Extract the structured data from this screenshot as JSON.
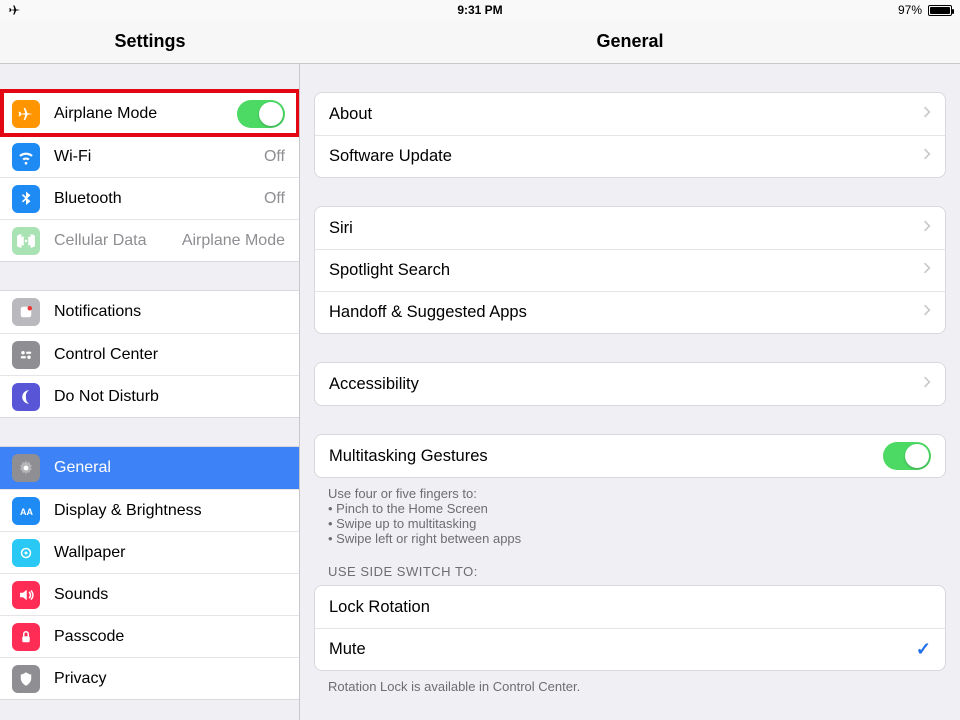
{
  "status": {
    "time": "9:31 PM",
    "battery_pct": "97%"
  },
  "header": {
    "left_title": "Settings",
    "right_title": "General"
  },
  "sidebar": {
    "group1": {
      "airplane": {
        "label": "Airplane Mode",
        "on": true
      },
      "wifi": {
        "label": "Wi-Fi",
        "value": "Off"
      },
      "bluetooth": {
        "label": "Bluetooth",
        "value": "Off"
      },
      "cellular": {
        "label": "Cellular Data",
        "value": "Airplane Mode"
      }
    },
    "group2": {
      "notifications": {
        "label": "Notifications"
      },
      "controlcenter": {
        "label": "Control Center"
      },
      "dnd": {
        "label": "Do Not Disturb"
      }
    },
    "group3": {
      "general": {
        "label": "General"
      },
      "display": {
        "label": "Display & Brightness"
      },
      "wallpaper": {
        "label": "Wallpaper"
      },
      "sounds": {
        "label": "Sounds"
      },
      "passcode": {
        "label": "Passcode"
      },
      "privacy": {
        "label": "Privacy"
      }
    }
  },
  "detail": {
    "g1": {
      "about": "About",
      "software_update": "Software Update"
    },
    "g2": {
      "siri": "Siri",
      "spotlight": "Spotlight Search",
      "handoff": "Handoff & Suggested Apps"
    },
    "g3": {
      "accessibility": "Accessibility"
    },
    "g4": {
      "multitasking": "Multitasking Gestures",
      "multitasking_on": true,
      "footer_intro": "Use four or five fingers to:",
      "footer_b1": "• Pinch to the Home Screen",
      "footer_b2": "• Swipe up to multitasking",
      "footer_b3": "• Swipe left or right between apps"
    },
    "side_switch_header": "USE SIDE SWITCH TO:",
    "g5": {
      "lock_rotation": "Lock Rotation",
      "mute": "Mute",
      "mute_selected": true
    },
    "g5_footer": "Rotation Lock is available in Control Center."
  }
}
